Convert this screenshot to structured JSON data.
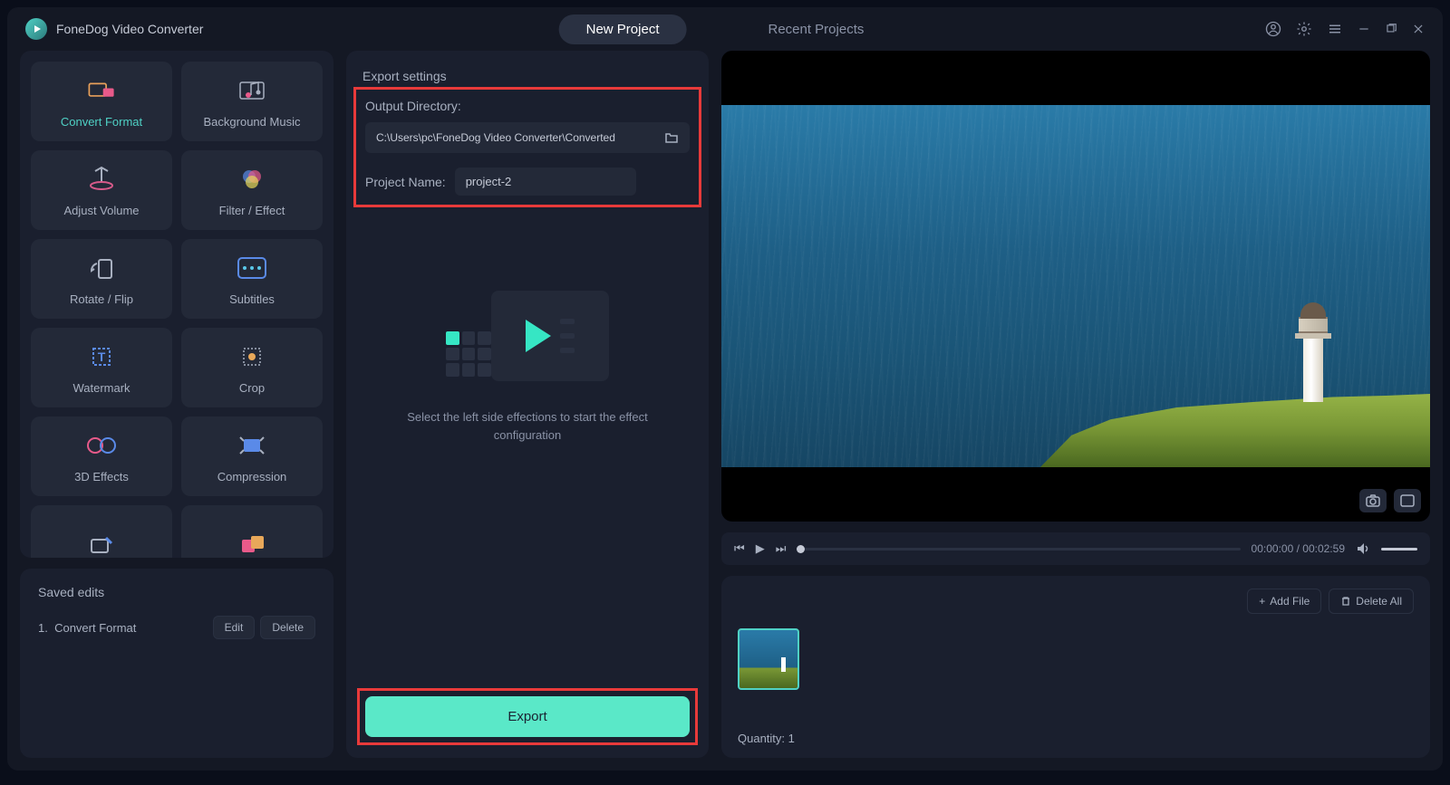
{
  "app": {
    "title": "FoneDog Video Converter"
  },
  "tabs": {
    "new_project": "New Project",
    "recent_projects": "Recent Projects"
  },
  "tools": [
    {
      "id": "convert-format",
      "label": "Convert Format",
      "active": true
    },
    {
      "id": "background-music",
      "label": "Background Music"
    },
    {
      "id": "adjust-volume",
      "label": "Adjust Volume"
    },
    {
      "id": "filter-effect",
      "label": "Filter / Effect"
    },
    {
      "id": "rotate-flip",
      "label": "Rotate / Flip"
    },
    {
      "id": "subtitles",
      "label": "Subtitles"
    },
    {
      "id": "watermark",
      "label": "Watermark"
    },
    {
      "id": "crop",
      "label": "Crop"
    },
    {
      "id": "3d-effects",
      "label": "3D Effects"
    },
    {
      "id": "compression",
      "label": "Compression"
    }
  ],
  "saved": {
    "title": "Saved edits",
    "items": [
      {
        "index": "1.",
        "name": "Convert Format"
      }
    ],
    "edit": "Edit",
    "delete": "Delete"
  },
  "export": {
    "title": "Export settings",
    "output_directory_label": "Output Directory:",
    "output_directory_path": "C:\\Users\\pc\\FoneDog Video Converter\\Converted",
    "project_name_label": "Project Name:",
    "project_name_value": "project-2",
    "placeholder_text": "Select the left side effections to start the effect configuration",
    "button": "Export"
  },
  "player": {
    "time_current": "00:00:00",
    "time_total": "00:02:59"
  },
  "files": {
    "add_file": "Add File",
    "delete_all": "Delete All",
    "quantity_label": "Quantity:",
    "quantity_value": "1"
  }
}
